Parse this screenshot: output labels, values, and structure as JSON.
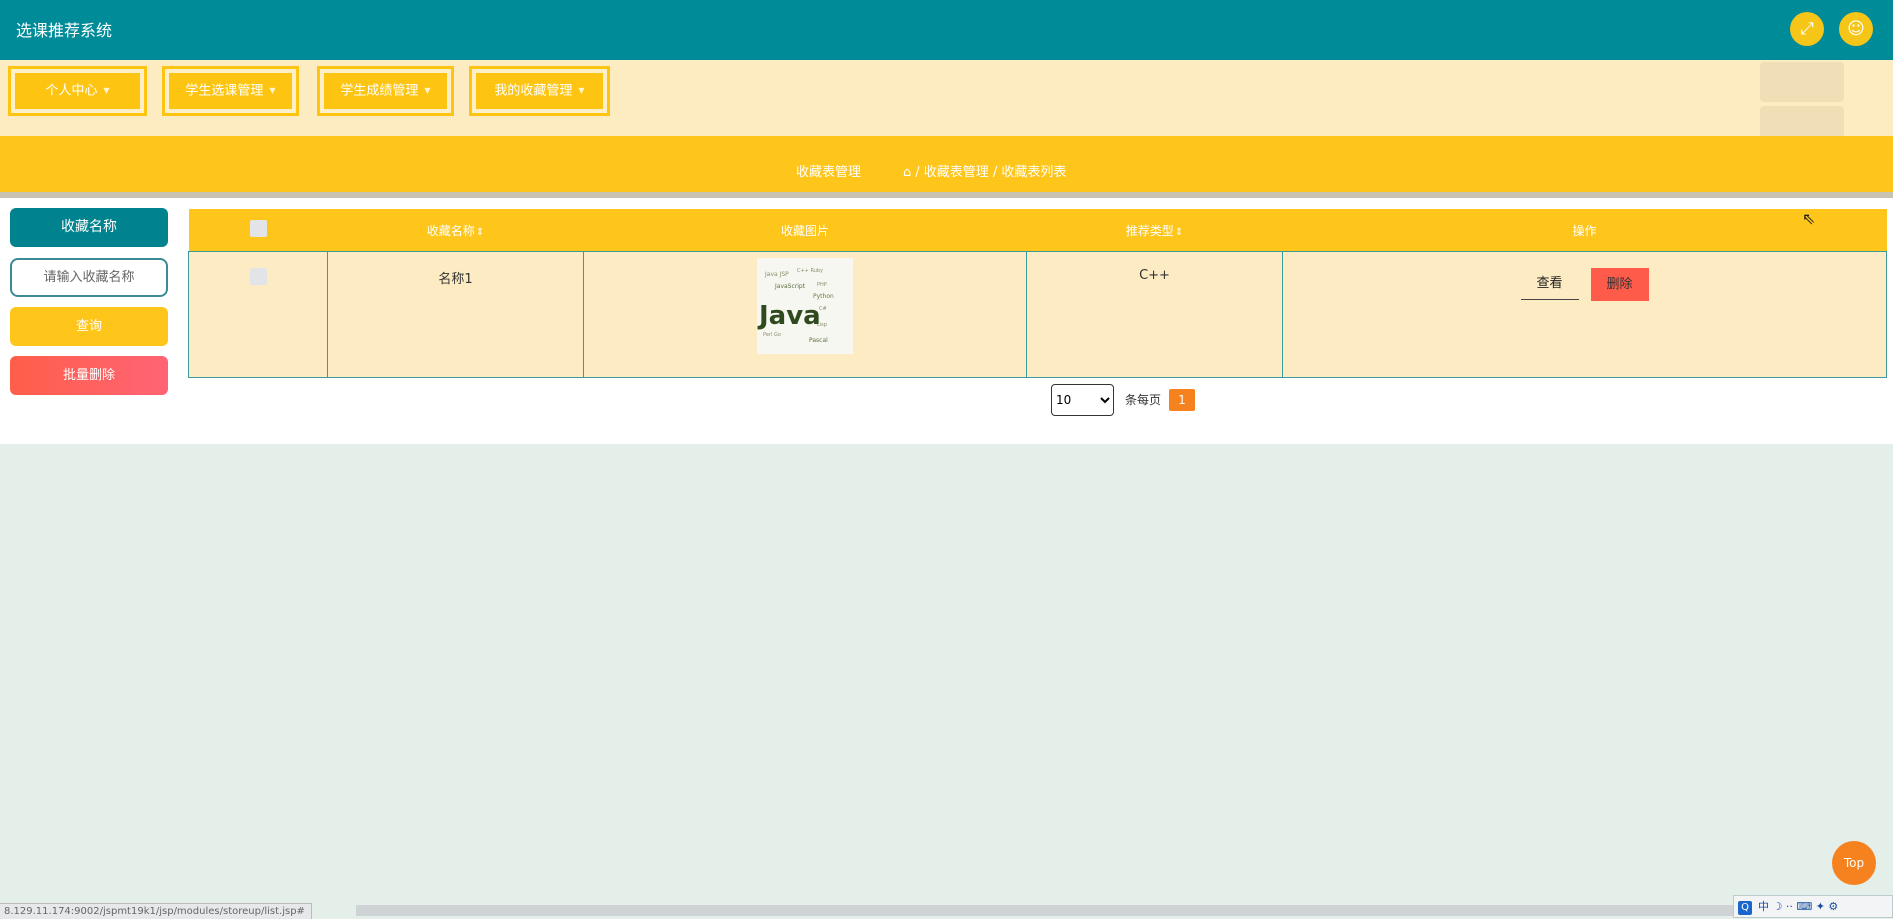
{
  "app": {
    "title": "选课推荐系统"
  },
  "header": {
    "fullscreen_icon": "fullscreen-icon",
    "user_icon": "user-avatar-icon"
  },
  "nav": {
    "items": [
      {
        "label": "个人中心"
      },
      {
        "label": "学生选课管理"
      },
      {
        "label": "学生成绩管理"
      },
      {
        "label": "我的收藏管理"
      }
    ]
  },
  "breadcrumb": {
    "title": "收藏表管理",
    "path": "/ 收藏表管理 / 收藏表列表"
  },
  "search": {
    "label": "收藏名称",
    "placeholder": "请输入收藏名称",
    "query_button": "查询",
    "batch_delete_button": "批量删除"
  },
  "table": {
    "headers": {
      "name": "收藏名称",
      "image": "收藏图片",
      "type": "推荐类型",
      "actions": "操作"
    },
    "rows": [
      {
        "name": "名称1",
        "image_word": "Java",
        "type": "C++",
        "view": "查看",
        "delete": "删除"
      }
    ]
  },
  "pagination": {
    "page_size": "10",
    "per_page_label": "条每页",
    "current_page": "1"
  },
  "top_button": "Top",
  "status_bar": {
    "url": "8.129.11.174:9002/jspmt19k1/jsp/modules/storeup/list.jsp#"
  },
  "tray": {
    "ime": "中"
  },
  "colors": {
    "topbar": "#008b99",
    "accent": "#fec51a",
    "menu_bg": "#fdebc2",
    "danger": "#ff5b4b",
    "page_active": "#f6821f"
  }
}
